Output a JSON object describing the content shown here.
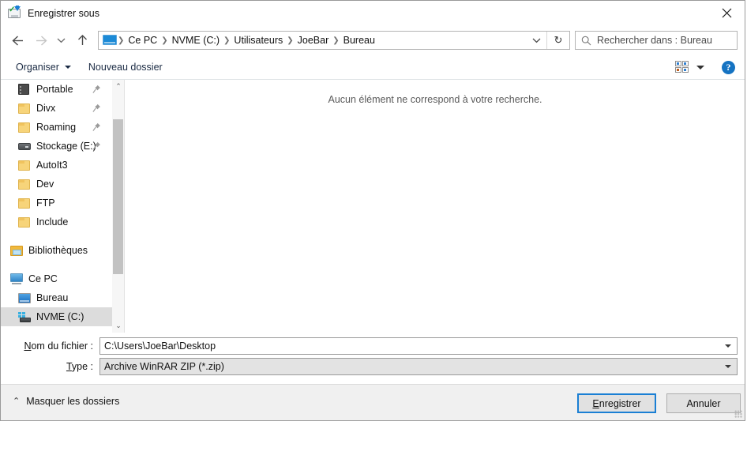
{
  "window": {
    "title": "Enregistrer sous",
    "icon": "save-as-icon",
    "close_label": "✕"
  },
  "nav": {
    "back_icon": "arrow-left-icon",
    "forward_icon": "arrow-right-icon",
    "recent_icon": "chevron-down-icon",
    "up_icon": "arrow-up-icon",
    "refresh_icon": "↻",
    "dropdown_icon": "chevron-down-icon"
  },
  "address": {
    "root_icon": "this-pc-icon",
    "separator": "❯",
    "crumbs": [
      "Ce PC",
      "NVME (C:)",
      "Utilisateurs",
      "JoeBar",
      "Bureau"
    ]
  },
  "search": {
    "icon": "search-icon",
    "placeholder": "Rechercher dans : Bureau"
  },
  "toolbar": {
    "organise_label": "Organiser",
    "new_folder_label": "Nouveau dossier",
    "view_icon": "tiles-view-icon",
    "view_caret_icon": "chevron-down-icon",
    "help_label": "?"
  },
  "sidebar": {
    "items": [
      {
        "label": "Portable",
        "icon": "portable-device-icon",
        "pinned": true,
        "indent": "indent1",
        "selected": false
      },
      {
        "label": "Divx",
        "icon": "folder-icon",
        "pinned": true,
        "indent": "indent1",
        "selected": false
      },
      {
        "label": "Roaming",
        "icon": "folder-icon",
        "pinned": true,
        "indent": "indent1",
        "selected": false
      },
      {
        "label": "Stockage (E:)",
        "icon": "drive-icon",
        "pinned": true,
        "indent": "indent1",
        "selected": false
      },
      {
        "label": "AutoIt3",
        "icon": "folder-icon",
        "pinned": false,
        "indent": "indent1",
        "selected": false
      },
      {
        "label": "Dev",
        "icon": "folder-icon",
        "pinned": false,
        "indent": "indent1",
        "selected": false
      },
      {
        "label": "FTP",
        "icon": "folder-icon",
        "pinned": false,
        "indent": "indent1",
        "selected": false
      },
      {
        "label": "Include",
        "icon": "folder-icon",
        "pinned": false,
        "indent": "indent1",
        "selected": false
      },
      {
        "label": "",
        "icon": "spacer",
        "pinned": false,
        "indent": "spacer",
        "selected": false
      },
      {
        "label": "Bibliothèques",
        "icon": "libraries-icon",
        "pinned": false,
        "indent": "root",
        "selected": false
      },
      {
        "label": "",
        "icon": "spacer",
        "pinned": false,
        "indent": "spacer",
        "selected": false
      },
      {
        "label": "Ce PC",
        "icon": "this-pc-icon",
        "pinned": false,
        "indent": "root",
        "selected": false
      },
      {
        "label": "Bureau",
        "icon": "desktop-icon",
        "pinned": false,
        "indent": "indent1",
        "selected": false
      },
      {
        "label": "NVME (C:)",
        "icon": "nvme-drive-icon",
        "pinned": false,
        "indent": "indent1",
        "selected": true
      }
    ],
    "scroll_up_icon": "⌃",
    "scroll_down_icon": "⌄"
  },
  "content": {
    "empty_message": "Aucun élément ne correspond à votre recherche."
  },
  "fields": {
    "filename_label_prefix": "N",
    "filename_label_rest": "om du fichier :",
    "filename_value": "C:\\Users\\JoeBar\\Desktop",
    "type_label_prefix": "T",
    "type_label_rest": "ype :",
    "type_value": "Archive WinRAR ZIP (*.zip)"
  },
  "footer": {
    "hide_folders_icon": "⌃",
    "hide_folders_label": "Masquer les dossiers",
    "save_prefix": "E",
    "save_rest": "nregistrer",
    "cancel_label": "Annuler"
  },
  "colors": {
    "accent": "#1a7fd4",
    "selection": "#dcdcdc",
    "footer_bg": "#f0f0f0",
    "help_blue": "#1573c2"
  }
}
